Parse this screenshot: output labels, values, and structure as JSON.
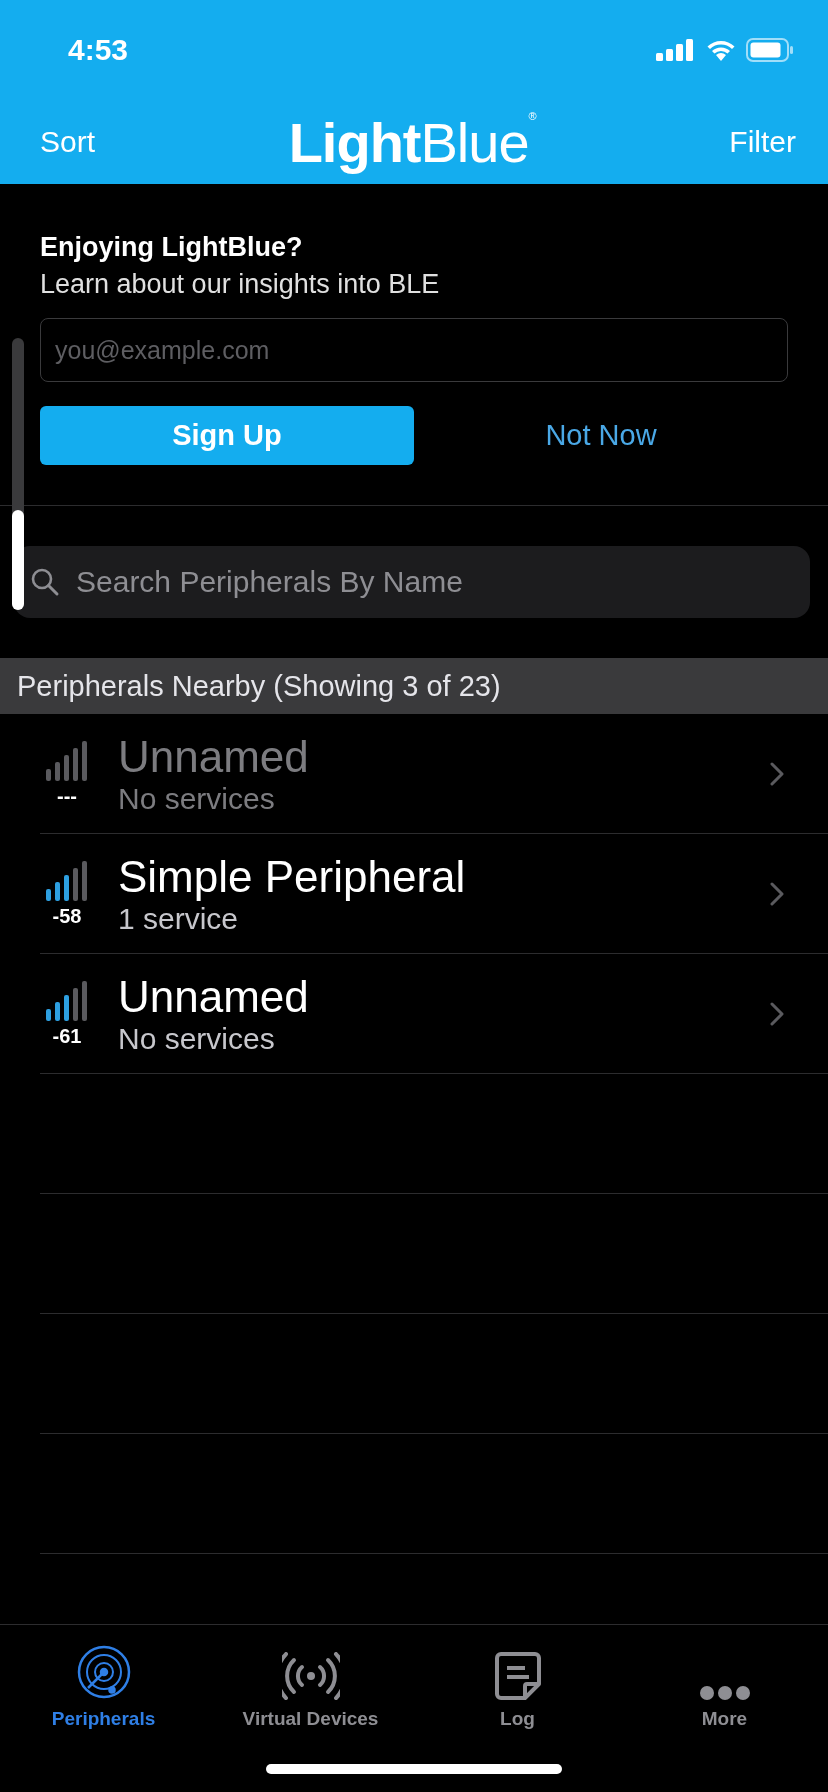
{
  "status_bar": {
    "time": "4:53"
  },
  "nav": {
    "left": "Sort",
    "logo": "**Light**Blue$^{®}$",
    "right": "Filter"
  },
  "promo": {
    "title": "Enjoying LightBlue?",
    "subtitle": "Learn about our insights into BLE",
    "email": {
      "placeholder": "you@example.com"
    },
    "primary": "Sign Up",
    "secondary": "Not Now"
  },
  "search": {
    "placeholder": "Search Peripherals By Name"
  },
  "section_header": "Peripherals Nearby (Showing 3 of 23)",
  "peripherals": [
    {
      "name": "Unnamed",
      "services": "No services",
      "rssi": "---",
      "level": 0,
      "stale": true
    },
    {
      "name": "Simple Peripheral",
      "services": "1 service",
      "rssi": "-58",
      "level": 0.6,
      "stale": false
    },
    {
      "name": "Unnamed",
      "services": "No services",
      "rssi": "-61",
      "level": 0.6,
      "stale": false
    }
  ],
  "tabs": [
    {
      "label": "Peripherals",
      "kind": "radar",
      "selected": true
    },
    {
      "label": "Virtual Devices",
      "kind": "broadcast",
      "selected": false
    },
    {
      "label": "Log",
      "kind": "note",
      "selected": false
    },
    {
      "label": "More",
      "kind": "dots",
      "selected": false
    }
  ]
}
